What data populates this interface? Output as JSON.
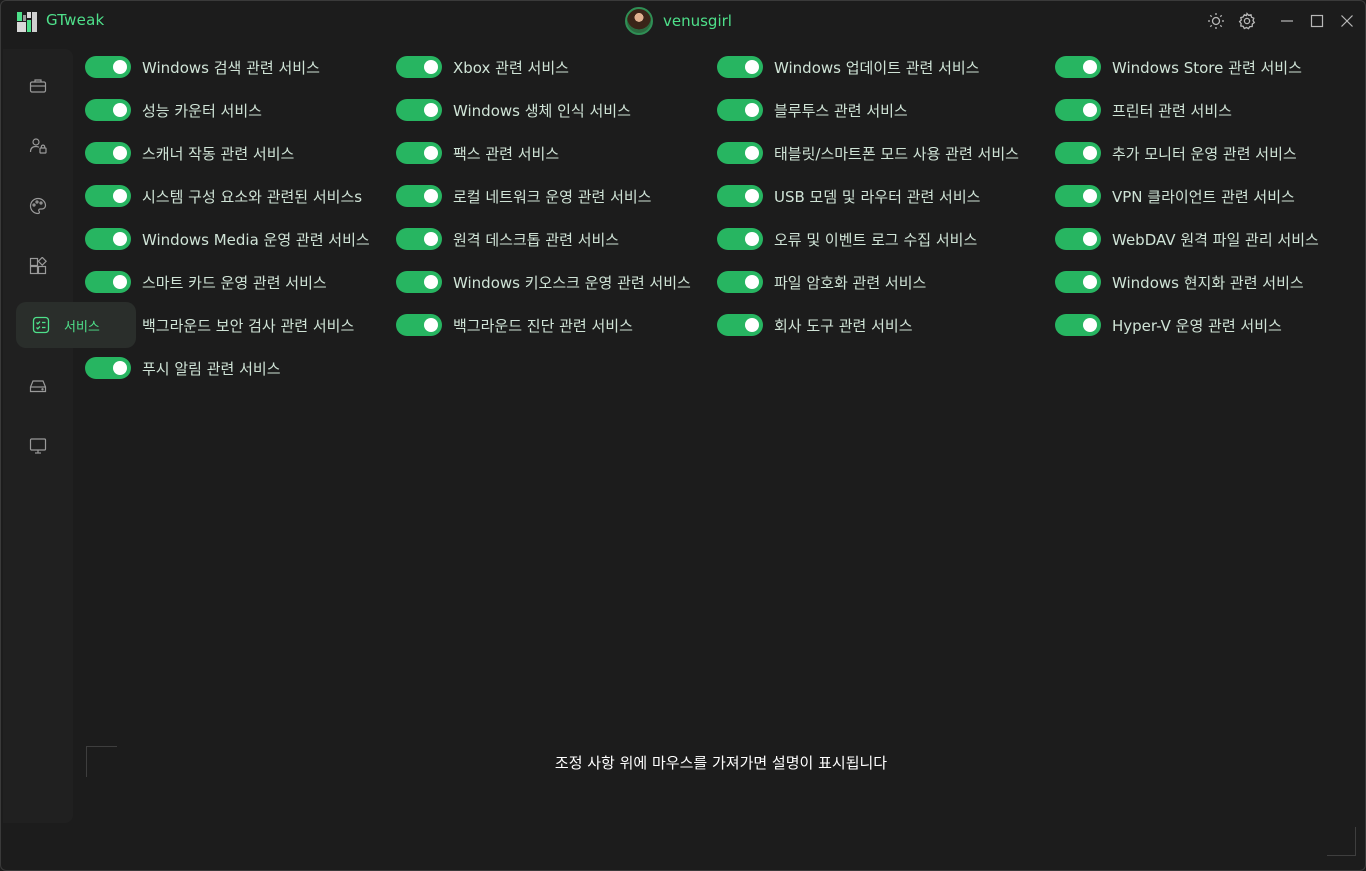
{
  "app": {
    "title": "GTweak",
    "user_name": "venusgirl",
    "accent_color": "#4ee08a",
    "toggle_color": "#27b561"
  },
  "sidebar": {
    "items": [
      {
        "icon": "briefcase-icon"
      },
      {
        "icon": "user-lock-icon"
      },
      {
        "icon": "palette-icon"
      },
      {
        "icon": "apps-grid-icon"
      },
      {
        "icon": "services-checklist-icon",
        "label": "서비스",
        "active": true
      },
      {
        "icon": "drive-icon"
      },
      {
        "icon": "monitor-icon"
      }
    ]
  },
  "services": {
    "col1": [
      {
        "label": "Windows 검색 관련 서비스",
        "enabled": true
      },
      {
        "label": "성능 카운터 서비스",
        "enabled": true
      },
      {
        "label": "스캐너 작동 관련 서비스",
        "enabled": true
      },
      {
        "label": "시스템 구성 요소와 관련된 서비스s",
        "enabled": true
      },
      {
        "label": "Windows Media 운영 관련 서비스",
        "enabled": true
      },
      {
        "label": "스마트 카드 운영 관련 서비스",
        "enabled": true
      },
      {
        "label": "백그라운드 보안 검사 관련 서비스",
        "enabled": true
      },
      {
        "label": "푸시 알림 관련 서비스",
        "enabled": true
      }
    ],
    "col2": [
      {
        "label": "Xbox 관련 서비스",
        "enabled": true
      },
      {
        "label": "Windows 생체 인식 서비스",
        "enabled": true
      },
      {
        "label": "팩스 관련 서비스",
        "enabled": true
      },
      {
        "label": "로컬 네트워크 운영 관련 서비스",
        "enabled": true
      },
      {
        "label": "원격 데스크톱 관련 서비스",
        "enabled": true
      },
      {
        "label": "Windows 키오스크 운영 관련 서비스",
        "enabled": true
      },
      {
        "label": "백그라운드 진단 관련 서비스",
        "enabled": true
      }
    ],
    "col3": [
      {
        "label": "Windows 업데이트 관련 서비스",
        "enabled": true
      },
      {
        "label": "블루투스 관련 서비스",
        "enabled": true
      },
      {
        "label": "태블릿/스마트폰 모드 사용 관련 서비스",
        "enabled": true
      },
      {
        "label": "USB 모뎀 및 라우터 관련 서비스",
        "enabled": true
      },
      {
        "label": "오류 및 이벤트 로그 수집 서비스",
        "enabled": true
      },
      {
        "label": "파일 암호화 관련 서비스",
        "enabled": true
      },
      {
        "label": "회사 도구 관련 서비스",
        "enabled": true
      }
    ],
    "col4": [
      {
        "label": "Windows Store 관련 서비스",
        "enabled": true
      },
      {
        "label": "프린터 관련 서비스",
        "enabled": true
      },
      {
        "label": "추가 모니터 운영 관련 서비스",
        "enabled": true
      },
      {
        "label": "VPN 클라이언트 관련 서비스",
        "enabled": true
      },
      {
        "label": "WebDAV 원격 파일 관리 서비스",
        "enabled": true
      },
      {
        "label": "Windows 현지화 관련 서비스",
        "enabled": true
      },
      {
        "label": "Hyper-V 운영 관련 서비스",
        "enabled": true
      }
    ]
  },
  "description": {
    "text": "조정 사항 위에 마우스를 가져가면 설명이 표시됩니다"
  }
}
